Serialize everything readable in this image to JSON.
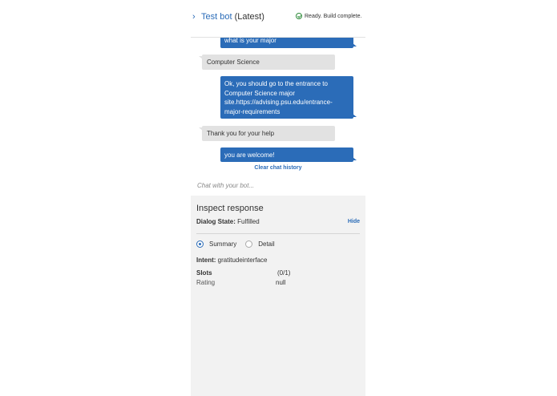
{
  "header": {
    "chevron": "›",
    "title": "Test bot",
    "subtitle": "(Latest)",
    "status": "Ready. Build complete."
  },
  "chat": {
    "messages": [
      {
        "from": "bot",
        "text": "what is your major"
      },
      {
        "from": "user",
        "text": "Computer Science"
      },
      {
        "from": "bot",
        "text": "Ok, you should go to the entrance to Computer Science major site.https://advising.psu.edu/entrance-major-requirements"
      },
      {
        "from": "user",
        "text": "Thank you for your help"
      },
      {
        "from": "bot",
        "text": "you are welcome!"
      }
    ],
    "clear_label": "Clear chat history",
    "input_placeholder": "Chat with your bot..."
  },
  "inspect": {
    "title": "Inspect response",
    "dialog_state_label": "Dialog State:",
    "dialog_state_value": "Fulfilled",
    "hide_label": "Hide",
    "views": [
      {
        "label": "Summary",
        "selected": true
      },
      {
        "label": "Detail",
        "selected": false
      }
    ],
    "intent_label": "Intent:",
    "intent_value": "gratitudeinterface",
    "slots_label": "Slots",
    "slots_count": "(0/1)",
    "slots": [
      {
        "name": "Rating",
        "value": "null"
      }
    ]
  },
  "colors": {
    "accent": "#2b6cb8",
    "bot_bubble": "#2b6cb8",
    "user_bubble": "#e2e2e2",
    "inspect_bg": "#f2f2f2",
    "status_ok": "#2e8b3a"
  }
}
